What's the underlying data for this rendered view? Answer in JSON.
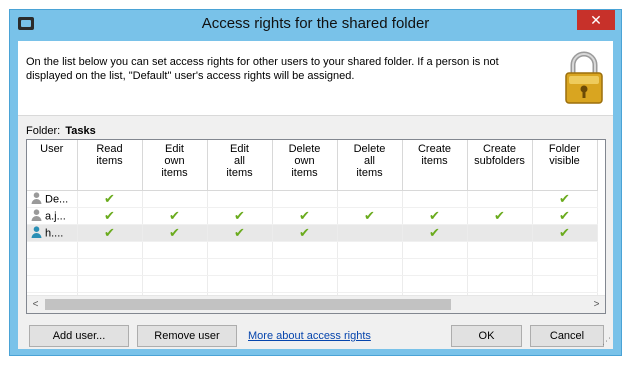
{
  "window": {
    "title": "Access rights for the shared folder",
    "close_glyph": "✕"
  },
  "description": "On the list below you can set access rights for other users to your shared folder. If a person is not displayed on the list, \"Default\" user's access rights will be assigned.",
  "folder": {
    "label": "Folder:",
    "name": "Tasks"
  },
  "grid": {
    "columns": [
      "User",
      "Read\nitems",
      "Edit\nown\nitems",
      "Edit\nall\nitems",
      "Delete\nown\nitems",
      "Delete\nall\nitems",
      "Create\nitems",
      "Create\nsubfolders",
      "Folder\nvisible"
    ],
    "rows": [
      {
        "user": "De...",
        "icon": "user-gray-icon",
        "rights": [
          true,
          false,
          false,
          false,
          false,
          false,
          false,
          true
        ]
      },
      {
        "user": "a.j...",
        "icon": "user-gray-icon",
        "rights": [
          true,
          true,
          true,
          true,
          true,
          true,
          true,
          true
        ]
      },
      {
        "user": "h....",
        "icon": "user-teal-icon",
        "rights": [
          true,
          true,
          true,
          true,
          false,
          true,
          false,
          true
        ],
        "selected": true
      }
    ],
    "check_glyph": "✔",
    "scroll_left": "<",
    "scroll_right": ">"
  },
  "buttons": {
    "add_user": "Add user...",
    "remove_user": "Remove user",
    "more_link": "More about access rights",
    "ok": "OK",
    "cancel": "Cancel"
  },
  "colors": {
    "title_bar": "#79c2e9",
    "close": "#c7312a",
    "check": "#6aab1d",
    "link": "#0645ad"
  }
}
